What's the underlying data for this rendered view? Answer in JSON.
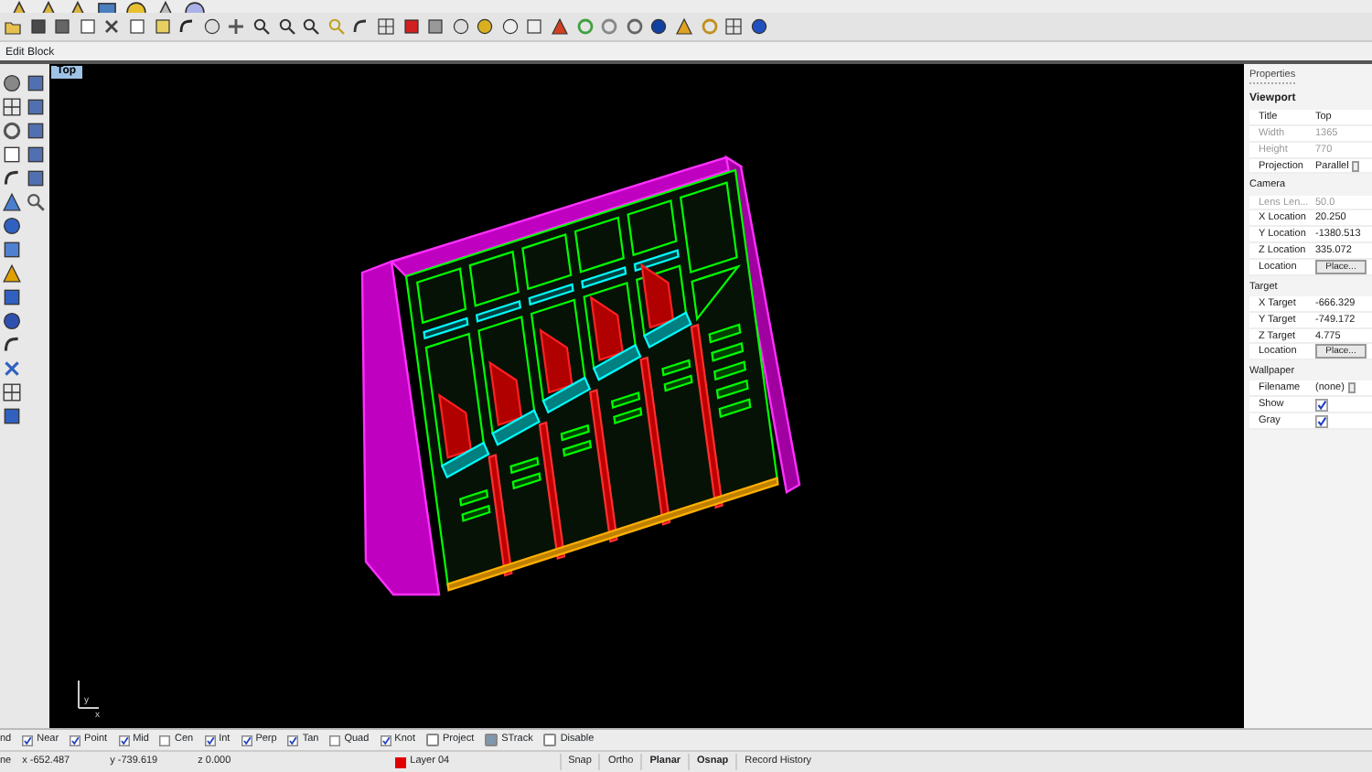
{
  "command_prompt": "Edit Block",
  "viewport": {
    "tab": "Top",
    "axis_labels": [
      "y",
      "x"
    ]
  },
  "properties": {
    "title": "Properties",
    "sections": [
      {
        "title": "Viewport",
        "heading": true,
        "rows": [
          {
            "label": "Title",
            "value": "Top",
            "kind": "text",
            "disabled": false
          },
          {
            "label": "Width",
            "value": "1365",
            "kind": "text",
            "disabled": true
          },
          {
            "label": "Height",
            "value": "770",
            "kind": "text",
            "disabled": true
          },
          {
            "label": "Projection",
            "value": "Parallel",
            "kind": "select",
            "disabled": false
          }
        ]
      },
      {
        "title": "Camera",
        "heading": false,
        "rows": [
          {
            "label": "Lens Len...",
            "value": "50.0",
            "kind": "text",
            "disabled": true
          },
          {
            "label": "X Location",
            "value": "20.250",
            "kind": "text",
            "disabled": false
          },
          {
            "label": "Y Location",
            "value": "-1380.513",
            "kind": "text",
            "disabled": false
          },
          {
            "label": "Z Location",
            "value": "335.072",
            "kind": "text",
            "disabled": false
          },
          {
            "label": "Location",
            "value": "Place...",
            "kind": "button",
            "disabled": false
          }
        ]
      },
      {
        "title": "Target",
        "heading": false,
        "rows": [
          {
            "label": "X Target",
            "value": "-666.329",
            "kind": "text",
            "disabled": false
          },
          {
            "label": "Y Target",
            "value": "-749.172",
            "kind": "text",
            "disabled": false
          },
          {
            "label": "Z Target",
            "value": "4.775",
            "kind": "text",
            "disabled": false
          },
          {
            "label": "Location",
            "value": "Place...",
            "kind": "button",
            "disabled": false
          }
        ]
      },
      {
        "title": "Wallpaper",
        "heading": false,
        "rows": [
          {
            "label": "Filename",
            "value": "(none)",
            "kind": "browse",
            "disabled": false
          },
          {
            "label": "Show",
            "checked": true,
            "kind": "check",
            "disabled": false
          },
          {
            "label": "Gray",
            "checked": true,
            "kind": "check",
            "disabled": false
          }
        ]
      }
    ]
  },
  "osnap": {
    "cut_label": "nd",
    "items": [
      {
        "label": "Near",
        "checked": true
      },
      {
        "label": "Point",
        "checked": true
      },
      {
        "label": "Mid",
        "checked": true
      },
      {
        "label": "Cen",
        "checked": false
      },
      {
        "label": "Int",
        "checked": true
      },
      {
        "label": "Perp",
        "checked": true
      },
      {
        "label": "Tan",
        "checked": true
      },
      {
        "label": "Quad",
        "checked": false
      },
      {
        "label": "Knot",
        "checked": true
      }
    ],
    "toggles": [
      {
        "label": "Project",
        "checked": false
      },
      {
        "label": "STrack",
        "checked": true
      },
      {
        "label": "Disable",
        "checked": false
      }
    ]
  },
  "status_bar": {
    "plane": "ne",
    "x": "x -652.487",
    "y": "y -739.619",
    "z": "z 0.000",
    "layer": {
      "name": "Layer 04",
      "color": "#e00000"
    },
    "panes": [
      {
        "label": "Snap",
        "on": false
      },
      {
        "label": "Ortho",
        "on": false
      },
      {
        "label": "Planar",
        "on": true
      },
      {
        "label": "Osnap",
        "on": true
      },
      {
        "label": "Record History",
        "on": false
      }
    ]
  }
}
